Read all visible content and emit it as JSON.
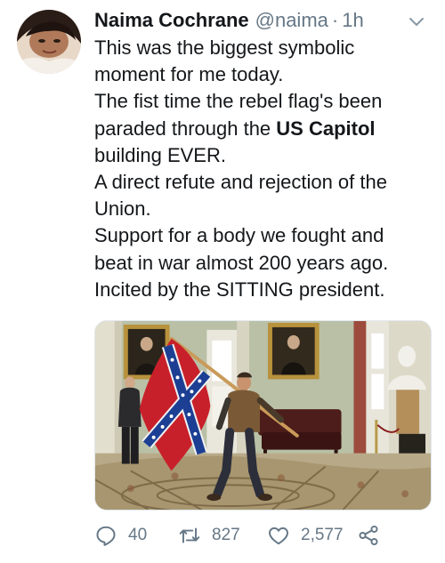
{
  "author": {
    "name": "Naima Cochrane",
    "handle": "@naima",
    "separator": "·",
    "time": "1h"
  },
  "tweet": {
    "lines": [
      "This was the biggest symbolic",
      "moment for me today.",
      "The fist time the rebel flag's been",
      "paraded through the ",
      "US Capitol",
      "building EVER.",
      "A direct refute and rejection of the",
      "Union.",
      "Support for a body we fought and",
      "beat in war almost 200 years ago.",
      "Incited by the SITTING president."
    ]
  },
  "stats": {
    "replies": "40",
    "retweets": "827",
    "likes": "2,577"
  },
  "icons": {
    "reply": "reply-icon",
    "retweet": "retweet-icon",
    "like": "heart-icon",
    "share": "share-icon",
    "menu": "chevron-down-icon"
  },
  "colors": {
    "text": "#14171a",
    "muted": "#657786",
    "flag_red": "#c8202a",
    "flag_blue": "#1c3f94"
  }
}
